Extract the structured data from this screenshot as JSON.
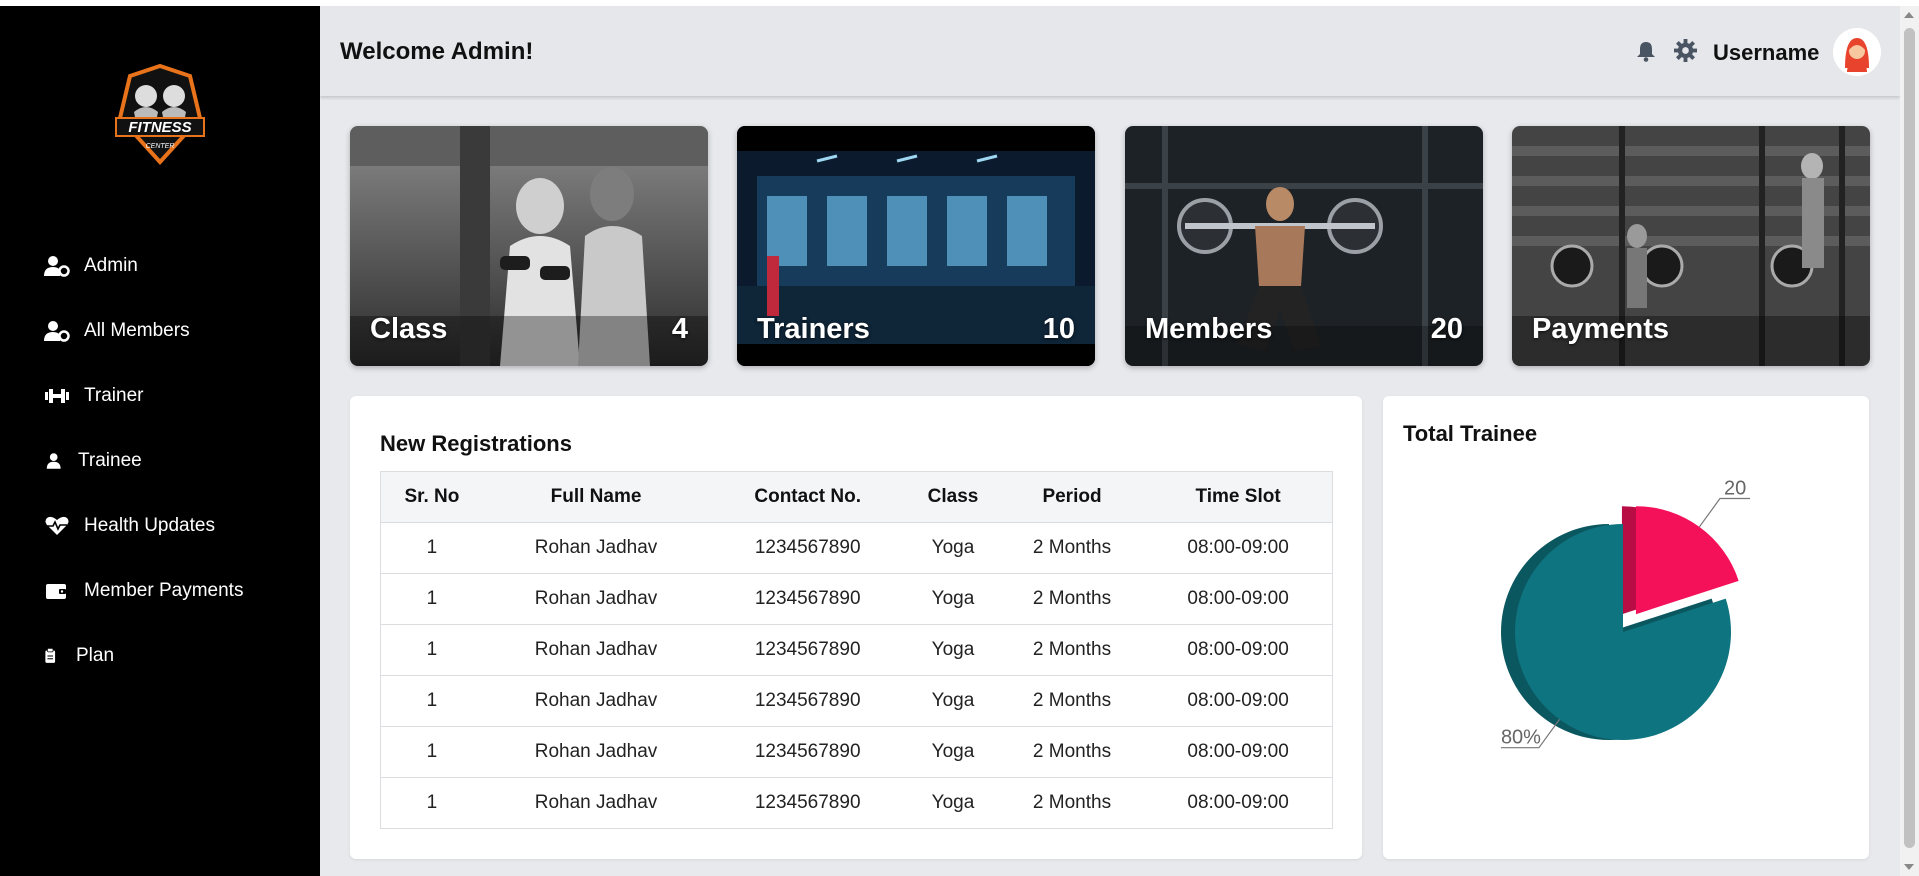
{
  "sidebar": {
    "logo_text": "FITNESS",
    "logo_sub": "CENTER",
    "items": [
      {
        "label": "Admin",
        "icon": "user-gear-icon"
      },
      {
        "label": "All Members",
        "icon": "user-gear-icon"
      },
      {
        "label": "Trainer",
        "icon": "dumbbell-icon"
      },
      {
        "label": "Trainee",
        "icon": "user-icon"
      },
      {
        "label": "Health Updates",
        "icon": "heart-pulse-icon"
      },
      {
        "label": "Member Payments",
        "icon": "wallet-icon"
      },
      {
        "label": "Plan",
        "icon": "clipboard-icon"
      }
    ]
  },
  "header": {
    "welcome": "Welcome Admin!",
    "username": "Username",
    "icons": [
      "bell-icon",
      "gear-icon"
    ]
  },
  "cards": [
    {
      "title": "Class",
      "count": "4"
    },
    {
      "title": "Trainers",
      "count": "10"
    },
    {
      "title": "Members",
      "count": "20"
    },
    {
      "title": "Payments",
      "count": ""
    }
  ],
  "registrations": {
    "title": "New Registrations",
    "columns": [
      "Sr. No",
      "Full Name",
      "Contact No.",
      "Class",
      "Period",
      "Time Slot"
    ],
    "rows": [
      [
        "1",
        "Rohan Jadhav",
        "1234567890",
        "Yoga",
        "2 Months",
        "08:00-09:00"
      ],
      [
        "1",
        "Rohan Jadhav",
        "1234567890",
        "Yoga",
        "2 Months",
        "08:00-09:00"
      ],
      [
        "1",
        "Rohan Jadhav",
        "1234567890",
        "Yoga",
        "2 Months",
        "08:00-09:00"
      ],
      [
        "1",
        "Rohan Jadhav",
        "1234567890",
        "Yoga",
        "2 Months",
        "08:00-09:00"
      ],
      [
        "1",
        "Rohan Jadhav",
        "1234567890",
        "Yoga",
        "2 Months",
        "08:00-09:00"
      ],
      [
        "1",
        "Rohan Jadhav",
        "1234567890",
        "Yoga",
        "2 Months",
        "08:00-09:00"
      ]
    ]
  },
  "chart_data": {
    "type": "pie",
    "title": "Total Trainee",
    "slices": [
      {
        "label": "80%",
        "value": 80,
        "color": "#0e7480"
      },
      {
        "label": "20",
        "value": 20,
        "color": "#f5105a"
      }
    ]
  },
  "colors": {
    "sidebar_bg": "#000000",
    "page_bg": "#e8e9ed",
    "teal": "#0e7480",
    "pink": "#f5105a"
  }
}
